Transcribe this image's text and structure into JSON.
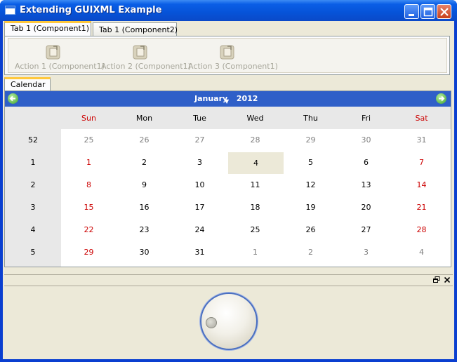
{
  "window": {
    "title": "Extending GUIXML Example"
  },
  "tabs": [
    {
      "label": "Tab 1  (Component1)",
      "active": true
    },
    {
      "label": "Tab 1  (Component2)",
      "active": false
    }
  ],
  "actions": [
    {
      "label": "Action 1 (Component1)",
      "icon": "action-icon"
    },
    {
      "label": "Action 2 (Component1)",
      "icon": "action-icon"
    },
    {
      "label": "Action 3 (Component1)",
      "icon": "action-icon"
    }
  ],
  "calendar": {
    "tab_label": "Calendar",
    "month": "January",
    "year": "2012",
    "days_of_week": [
      "Sun",
      "Mon",
      "Tue",
      "Wed",
      "Thu",
      "Fri",
      "Sat"
    ],
    "weeks": [
      {
        "week": "52",
        "days": [
          "25",
          "26",
          "27",
          "28",
          "29",
          "30",
          "31"
        ]
      },
      {
        "week": "1",
        "days": [
          "1",
          "2",
          "3",
          "4",
          "5",
          "6",
          "7"
        ]
      },
      {
        "week": "2",
        "days": [
          "8",
          "9",
          "10",
          "11",
          "12",
          "13",
          "14"
        ]
      },
      {
        "week": "3",
        "days": [
          "15",
          "16",
          "17",
          "18",
          "19",
          "20",
          "21"
        ]
      },
      {
        "week": "4",
        "days": [
          "22",
          "23",
          "24",
          "25",
          "26",
          "27",
          "28"
        ]
      },
      {
        "week": "5",
        "days": [
          "29",
          "30",
          "31",
          "1",
          "2",
          "3",
          "4"
        ]
      }
    ],
    "selected_day": "4",
    "weekend_color": "#cc0000",
    "header_color": "#2f5fc8"
  },
  "dock": {
    "float_icon": "float-icon",
    "close_icon": "close-icon"
  }
}
